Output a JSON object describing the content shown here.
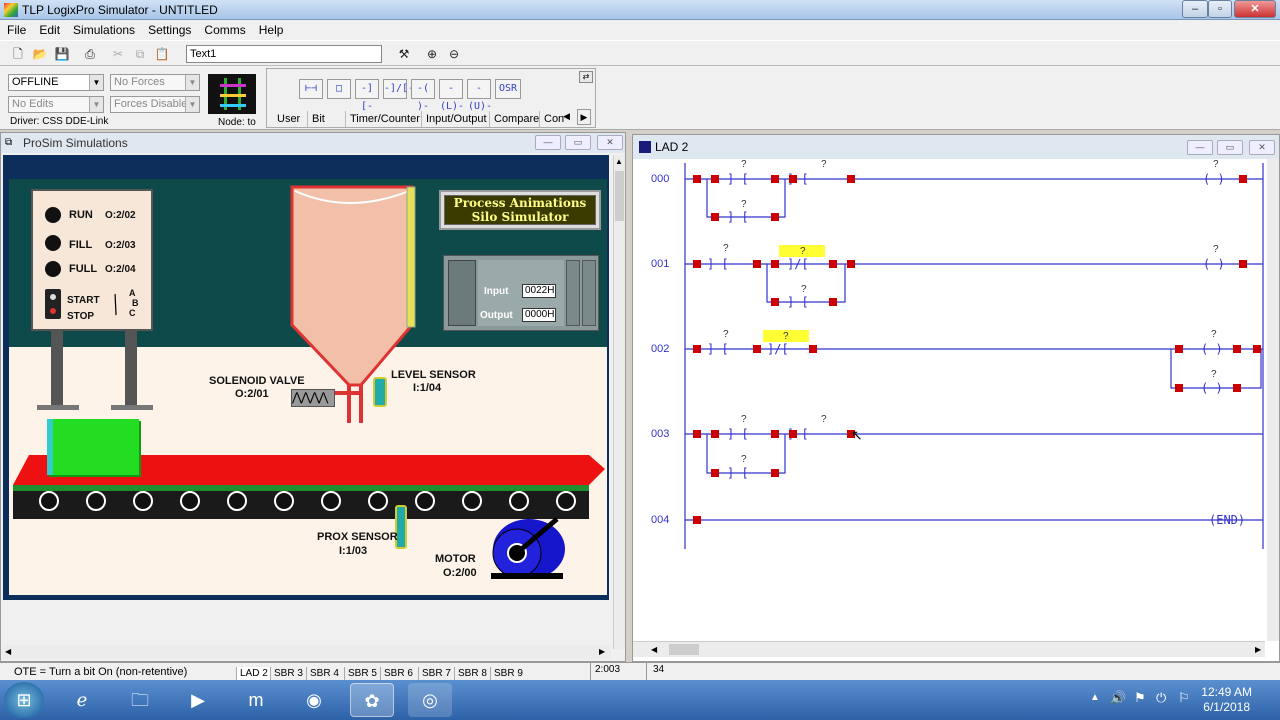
{
  "app": {
    "title": "TLP LogixPro Simulator - UNTITLED"
  },
  "menu": [
    "File",
    "Edit",
    "Simulations",
    "Settings",
    "Comms",
    "Help"
  ],
  "toolbar": {
    "text_field": "Text1"
  },
  "status_panel": {
    "mode": "OFFLINE",
    "forces": "No Forces",
    "edits": "No Edits",
    "forces_state": "Forces Disabled",
    "driver": "Driver: CSS DDE-Link",
    "node": "Node: to"
  },
  "instructions": {
    "buttons": [
      "⊢⊣",
      "□",
      "-] [-",
      "-]/[-",
      "-( )-",
      "-(L)-",
      "-(U)-",
      "OSR"
    ],
    "tabs": [
      "User",
      "Bit",
      "Timer/Counter",
      "Input/Output",
      "Compare",
      "Con"
    ]
  },
  "simwin": {
    "title": "ProSim Simulations",
    "panel_lights": [
      {
        "label": "RUN",
        "addr": "O:2/02"
      },
      {
        "label": "FILL",
        "addr": "O:2/03"
      },
      {
        "label": "FULL",
        "addr": "O:2/04"
      }
    ],
    "start": "START",
    "stop": "STOP",
    "selector": [
      "A",
      "B",
      "C"
    ],
    "banner_line1": "Process Animations",
    "banner_line2": "Silo Simulator",
    "io_input_label": "Input",
    "io_input_value": "0022H",
    "io_output_label": "Output",
    "io_output_value": "0000H",
    "solenoid_label": "SOLENOID VALVE",
    "solenoid_addr": "O:2/01",
    "level_label": "LEVEL SENSOR",
    "level_addr": "I:1/04",
    "prox_label": "PROX SENSOR",
    "prox_addr": "I:1/03",
    "motor_label": "MOTOR",
    "motor_addr": "O:2/00"
  },
  "ladwin": {
    "title": "LAD 2",
    "rungs": [
      "000",
      "001",
      "002",
      "003",
      "004"
    ],
    "end_label": "END",
    "q": "?"
  },
  "statusbar": {
    "hint": "OTE = Turn a bit On (non-retentive)",
    "tabs": [
      "LAD 2",
      "SBR 3",
      "SBR 4",
      "SBR 5",
      "SBR 6",
      "SBR 7",
      "SBR 8",
      "SBR 9"
    ],
    "position": "2:003",
    "count": "34"
  },
  "taskbar": {
    "time": "12:49 AM",
    "date": "6/1/2018"
  },
  "colors": {
    "rung": "#3333cc",
    "highlight": "#ffff33",
    "conveyor": "#ee1111",
    "box": "#22dd22"
  }
}
